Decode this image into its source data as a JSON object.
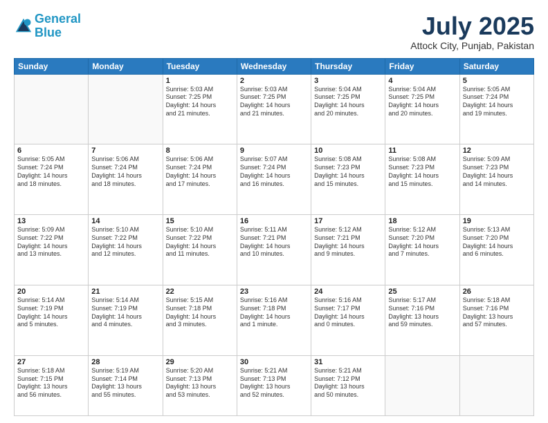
{
  "logo": {
    "line1": "General",
    "line2": "Blue"
  },
  "title": "July 2025",
  "location": "Attock City, Punjab, Pakistan",
  "days_header": [
    "Sunday",
    "Monday",
    "Tuesday",
    "Wednesday",
    "Thursday",
    "Friday",
    "Saturday"
  ],
  "weeks": [
    [
      {
        "day": "",
        "info": ""
      },
      {
        "day": "",
        "info": ""
      },
      {
        "day": "1",
        "info": "Sunrise: 5:03 AM\nSunset: 7:25 PM\nDaylight: 14 hours\nand 21 minutes."
      },
      {
        "day": "2",
        "info": "Sunrise: 5:03 AM\nSunset: 7:25 PM\nDaylight: 14 hours\nand 21 minutes."
      },
      {
        "day": "3",
        "info": "Sunrise: 5:04 AM\nSunset: 7:25 PM\nDaylight: 14 hours\nand 20 minutes."
      },
      {
        "day": "4",
        "info": "Sunrise: 5:04 AM\nSunset: 7:25 PM\nDaylight: 14 hours\nand 20 minutes."
      },
      {
        "day": "5",
        "info": "Sunrise: 5:05 AM\nSunset: 7:24 PM\nDaylight: 14 hours\nand 19 minutes."
      }
    ],
    [
      {
        "day": "6",
        "info": "Sunrise: 5:05 AM\nSunset: 7:24 PM\nDaylight: 14 hours\nand 18 minutes."
      },
      {
        "day": "7",
        "info": "Sunrise: 5:06 AM\nSunset: 7:24 PM\nDaylight: 14 hours\nand 18 minutes."
      },
      {
        "day": "8",
        "info": "Sunrise: 5:06 AM\nSunset: 7:24 PM\nDaylight: 14 hours\nand 17 minutes."
      },
      {
        "day": "9",
        "info": "Sunrise: 5:07 AM\nSunset: 7:24 PM\nDaylight: 14 hours\nand 16 minutes."
      },
      {
        "day": "10",
        "info": "Sunrise: 5:08 AM\nSunset: 7:23 PM\nDaylight: 14 hours\nand 15 minutes."
      },
      {
        "day": "11",
        "info": "Sunrise: 5:08 AM\nSunset: 7:23 PM\nDaylight: 14 hours\nand 15 minutes."
      },
      {
        "day": "12",
        "info": "Sunrise: 5:09 AM\nSunset: 7:23 PM\nDaylight: 14 hours\nand 14 minutes."
      }
    ],
    [
      {
        "day": "13",
        "info": "Sunrise: 5:09 AM\nSunset: 7:22 PM\nDaylight: 14 hours\nand 13 minutes."
      },
      {
        "day": "14",
        "info": "Sunrise: 5:10 AM\nSunset: 7:22 PM\nDaylight: 14 hours\nand 12 minutes."
      },
      {
        "day": "15",
        "info": "Sunrise: 5:10 AM\nSunset: 7:22 PM\nDaylight: 14 hours\nand 11 minutes."
      },
      {
        "day": "16",
        "info": "Sunrise: 5:11 AM\nSunset: 7:21 PM\nDaylight: 14 hours\nand 10 minutes."
      },
      {
        "day": "17",
        "info": "Sunrise: 5:12 AM\nSunset: 7:21 PM\nDaylight: 14 hours\nand 9 minutes."
      },
      {
        "day": "18",
        "info": "Sunrise: 5:12 AM\nSunset: 7:20 PM\nDaylight: 14 hours\nand 7 minutes."
      },
      {
        "day": "19",
        "info": "Sunrise: 5:13 AM\nSunset: 7:20 PM\nDaylight: 14 hours\nand 6 minutes."
      }
    ],
    [
      {
        "day": "20",
        "info": "Sunrise: 5:14 AM\nSunset: 7:19 PM\nDaylight: 14 hours\nand 5 minutes."
      },
      {
        "day": "21",
        "info": "Sunrise: 5:14 AM\nSunset: 7:19 PM\nDaylight: 14 hours\nand 4 minutes."
      },
      {
        "day": "22",
        "info": "Sunrise: 5:15 AM\nSunset: 7:18 PM\nDaylight: 14 hours\nand 3 minutes."
      },
      {
        "day": "23",
        "info": "Sunrise: 5:16 AM\nSunset: 7:18 PM\nDaylight: 14 hours\nand 1 minute."
      },
      {
        "day": "24",
        "info": "Sunrise: 5:16 AM\nSunset: 7:17 PM\nDaylight: 14 hours\nand 0 minutes."
      },
      {
        "day": "25",
        "info": "Sunrise: 5:17 AM\nSunset: 7:16 PM\nDaylight: 13 hours\nand 59 minutes."
      },
      {
        "day": "26",
        "info": "Sunrise: 5:18 AM\nSunset: 7:16 PM\nDaylight: 13 hours\nand 57 minutes."
      }
    ],
    [
      {
        "day": "27",
        "info": "Sunrise: 5:18 AM\nSunset: 7:15 PM\nDaylight: 13 hours\nand 56 minutes."
      },
      {
        "day": "28",
        "info": "Sunrise: 5:19 AM\nSunset: 7:14 PM\nDaylight: 13 hours\nand 55 minutes."
      },
      {
        "day": "29",
        "info": "Sunrise: 5:20 AM\nSunset: 7:13 PM\nDaylight: 13 hours\nand 53 minutes."
      },
      {
        "day": "30",
        "info": "Sunrise: 5:21 AM\nSunset: 7:13 PM\nDaylight: 13 hours\nand 52 minutes."
      },
      {
        "day": "31",
        "info": "Sunrise: 5:21 AM\nSunset: 7:12 PM\nDaylight: 13 hours\nand 50 minutes."
      },
      {
        "day": "",
        "info": ""
      },
      {
        "day": "",
        "info": ""
      }
    ]
  ]
}
